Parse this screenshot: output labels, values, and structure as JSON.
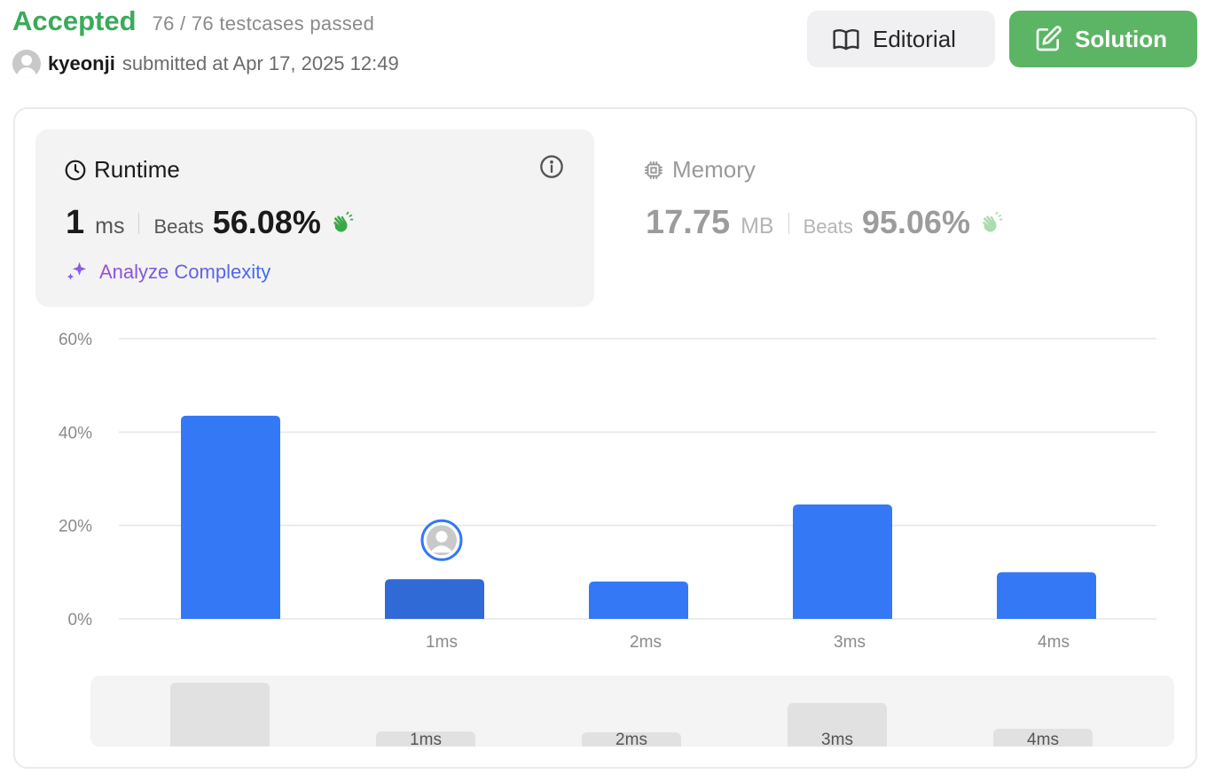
{
  "header": {
    "status": "Accepted",
    "testcases": "76 / 76 testcases passed",
    "username": "kyeonji",
    "submitted_text": "submitted at Apr 17, 2025 12:49",
    "editorial_label": "Editorial",
    "solution_label": "Solution",
    "solution_color": "#5cb565",
    "status_color": "#3aaa5b"
  },
  "runtime": {
    "title": "Runtime",
    "value": "1",
    "unit": "ms",
    "beats_label": "Beats",
    "beats_value": "56.08%",
    "analyze_label": "Analyze Complexity"
  },
  "memory": {
    "title": "Memory",
    "value": "17.75",
    "unit": "MB",
    "beats_label": "Beats",
    "beats_value": "95.06%"
  },
  "chart_data": {
    "type": "bar",
    "categories": [
      "",
      "1ms",
      "2ms",
      "3ms",
      "4ms"
    ],
    "values": [
      43.5,
      8.5,
      8,
      24.5,
      10
    ],
    "highlight_index": 1,
    "yticks": [
      "60%",
      "40%",
      "20%",
      "0%"
    ],
    "ylim": [
      0,
      60
    ],
    "grid": true,
    "bar_color": "#3478f6",
    "highlight_color": "#2f6ad6"
  },
  "minimap": {
    "labels": [
      "1ms",
      "2ms",
      "3ms",
      "4ms"
    ]
  }
}
